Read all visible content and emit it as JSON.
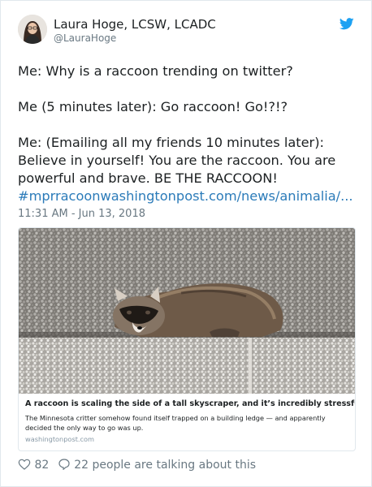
{
  "colors": {
    "link": "#2b7bb9",
    "twitter_blue": "#1da1f2",
    "secondary_text": "#697882",
    "primary_text": "#1c2022",
    "border": "#e1e8ed"
  },
  "author": {
    "name": "Laura Hoge, LCSW, LCADC",
    "handle": "@LauraHoge",
    "avatar_icon": "user-photo"
  },
  "header_icon": "twitter-bird-icon",
  "tweet": {
    "line1": "Me: Why is a raccoon trending on twitter?",
    "line2": "Me (5 minutes later): Go raccoon! Go!?!?",
    "line3": "Me: (Emailing all my friends 10 minutes later): Believe in yourself! You are the raccoon. You are powerful and brave. BE THE RACCOON!",
    "link": "#mprracoonwashingtonpost.com/news/animalia/...",
    "timestamp": "11:31 AM - Jun 13, 2018"
  },
  "card": {
    "image": "raccoon-on-building-ledge",
    "title": "A raccoon is scaling the side of a tall skyscraper, and it’s incredibly stressful",
    "description": "The Minnesota critter somehow found itself trapped on a building ledge — and apparently decided the only way to go was up.",
    "domain": "washingtonpost.com"
  },
  "actions": {
    "like_icon": "heart-icon",
    "like_count": "82",
    "reply_icon": "speech-bubble-icon",
    "talking_text": "22 people are talking about this"
  }
}
